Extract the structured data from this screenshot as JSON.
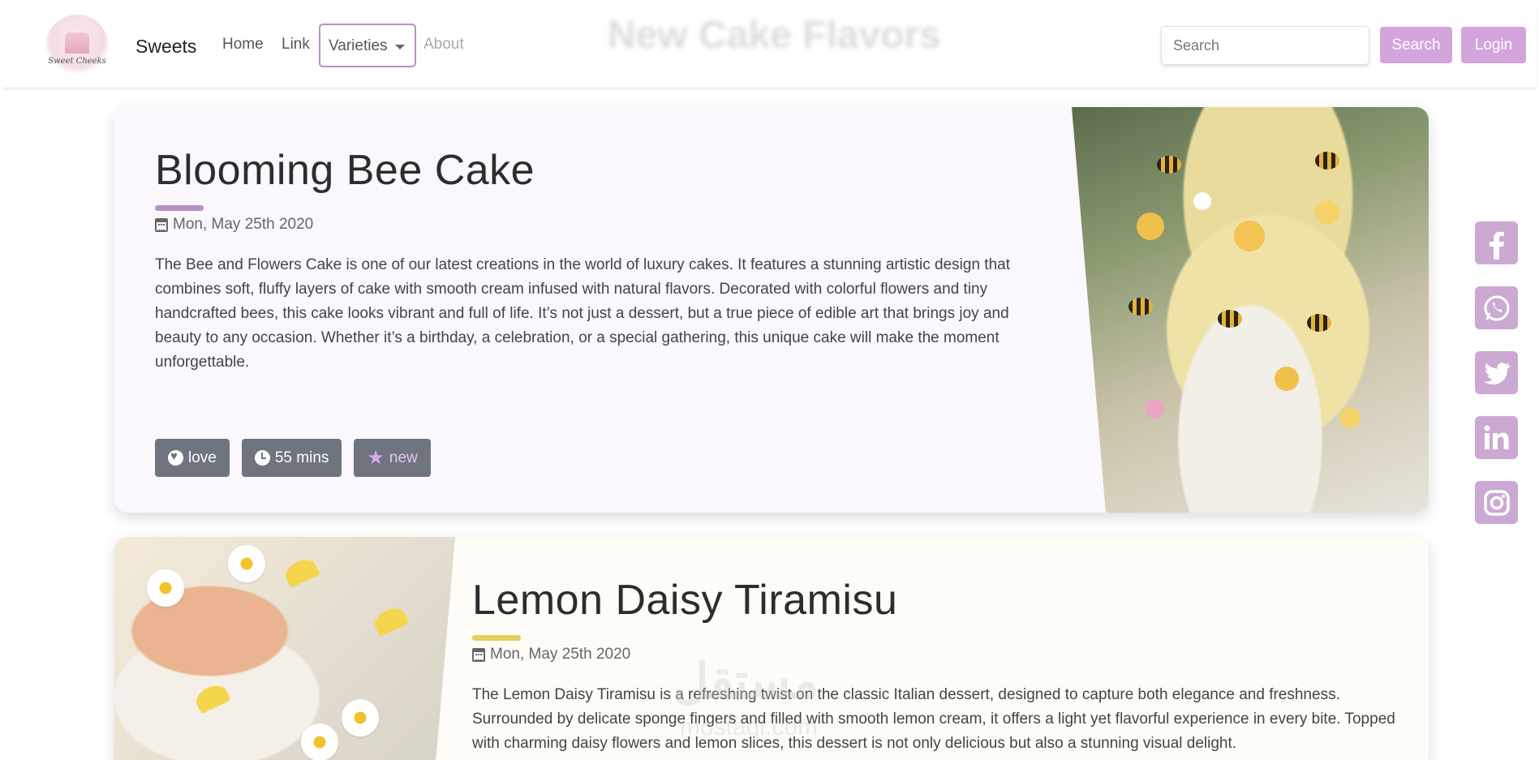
{
  "nav": {
    "logo_text": "Sweet Cheeks",
    "brand": "Sweets",
    "home": "Home",
    "link": "Link",
    "dropdown": "Varieties",
    "about": "About",
    "ghost_title": "New Cake Flavors",
    "search_placeholder": "Search",
    "search_button": "Search",
    "login_button": "Login"
  },
  "cards": [
    {
      "title": "Blooming Bee Cake",
      "accent": "#b98fc8",
      "date": "Mon, May 25th 2020",
      "description": "The Bee and Flowers Cake is one of our latest creations in the world of luxury cakes. It features a stunning artistic design that combines soft, fluffy layers of cake with smooth cream infused with natural flavors. Decorated with colorful flowers and tiny handcrafted bees, this cake looks vibrant and full of life. It’s not just a dessert, but a true piece of edible art that brings joy and beauty to any occasion. Whether it’s a birthday, a celebration, or a special gathering, this unique cake will make the moment unforgettable.",
      "tags": [
        "love",
        "55 mins",
        "new"
      ]
    },
    {
      "title": "Lemon Daisy Tiramisu",
      "accent": "#e3cf5a",
      "date": "Mon, May 25th 2020",
      "description": "The Lemon Daisy Tiramisu is a refreshing twist on the classic Italian dessert, designed to capture both elegance and freshness. Surrounded by delicate sponge fingers and filled with smooth lemon cream, it offers a light yet flavorful experience in every bite. Topped with charming daisy flowers and lemon slices, this dessert is not only delicious but also a stunning visual delight."
    }
  ],
  "social": [
    "facebook-icon",
    "whatsapp-icon",
    "twitter-icon",
    "linkedin-icon",
    "instagram-icon"
  ],
  "watermark": {
    "arabic": "مستقل",
    "latin": "mostaql.com"
  },
  "colors": {
    "button_purple": "#d4a4dd",
    "social_purple": "#cba9d3",
    "tag_gray": "#6e757f"
  }
}
